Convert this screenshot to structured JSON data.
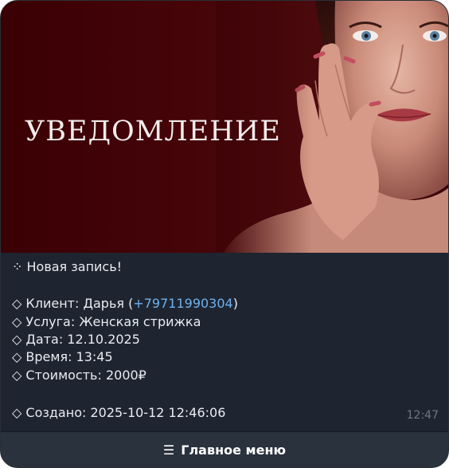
{
  "banner": {
    "title": "УВЕДОМЛЕНИЕ"
  },
  "message": {
    "header": "⁘ Новая запись!",
    "client_label": "◇ Клиент: Дарья (",
    "client_phone": "+79711990304",
    "client_close": ")",
    "service": "◇ Услуга: Женская стрижка",
    "date": "◇ Дата: 12.10.2025",
    "time": "◇ Время: 13:45",
    "price": "◇ Стоимость: 2000₽",
    "created": "◇ Создано: 2025-10-12 12:46:06",
    "sent_time": "12:47"
  },
  "keyboard": {
    "menu_icon": "☰",
    "main_menu": "Главное меню"
  },
  "colors": {
    "banner_bg": "#3a0004",
    "message_bg": "#1e2530",
    "link": "#6fb1ef",
    "button_bg": "#2a323d"
  }
}
